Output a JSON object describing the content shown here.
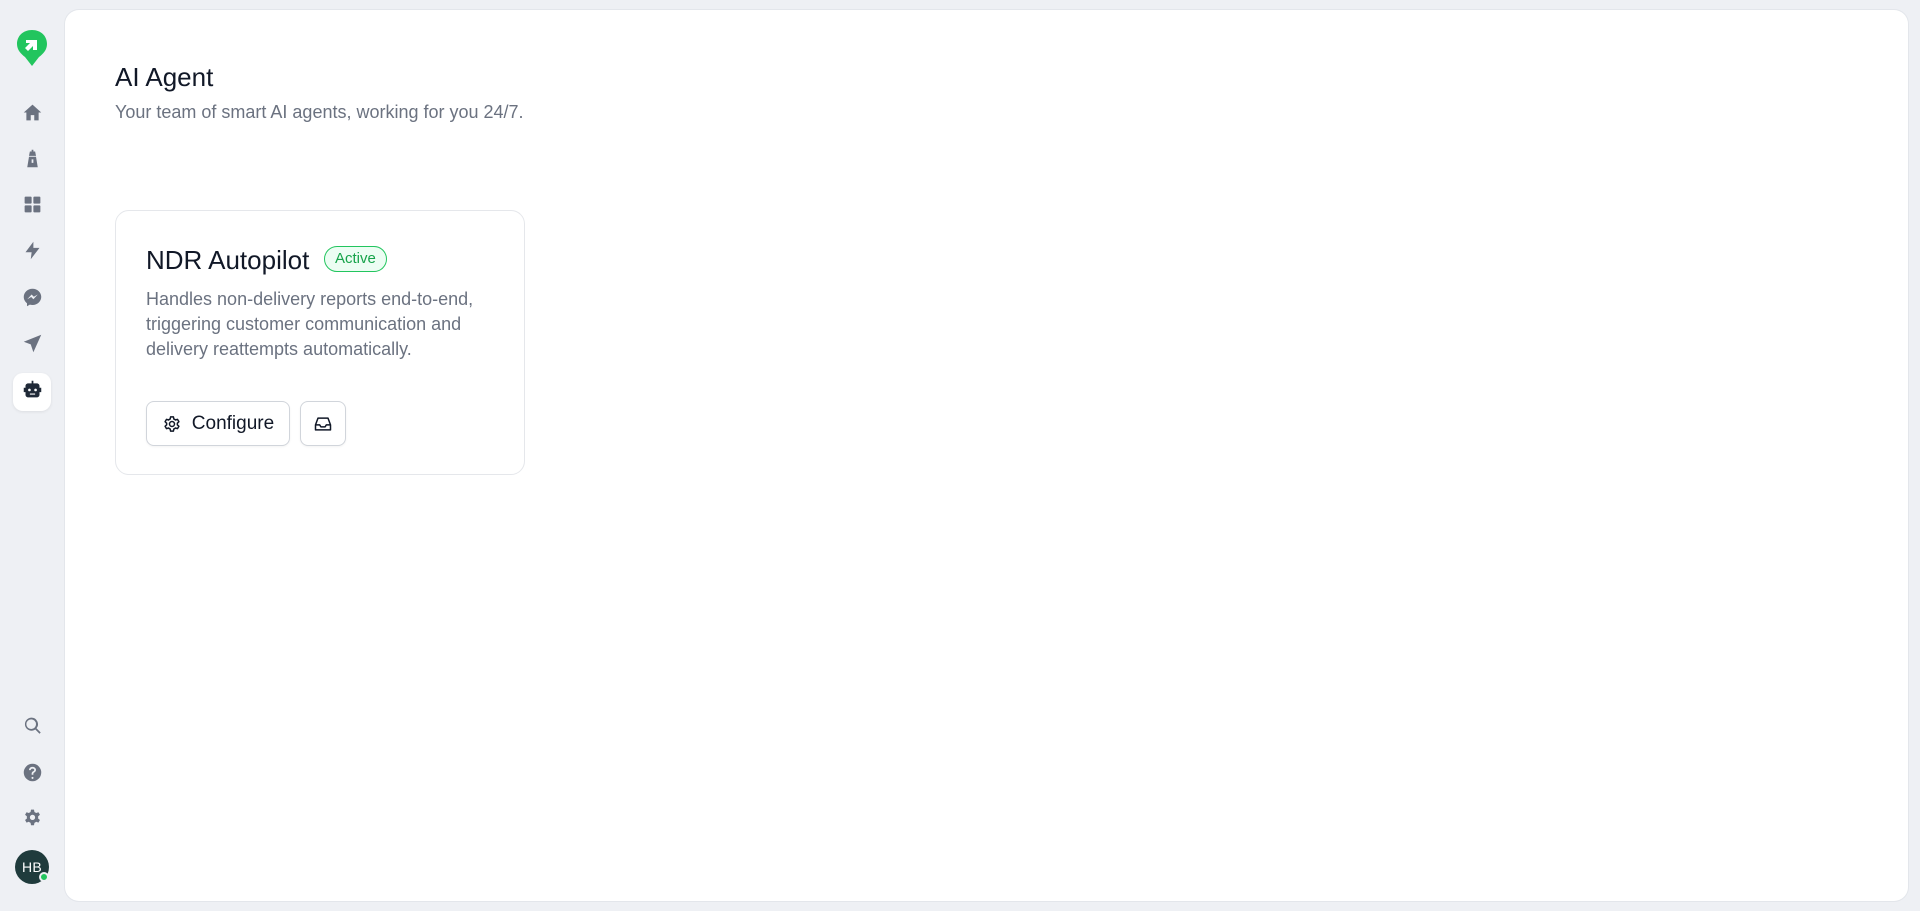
{
  "sidebar": {
    "logo": "brand-logo",
    "nav_items": [
      {
        "icon": "home-icon",
        "active": false
      },
      {
        "icon": "lighthouse-icon",
        "active": false
      },
      {
        "icon": "grid-icon",
        "active": false
      },
      {
        "icon": "lightning-icon",
        "active": false
      },
      {
        "icon": "chat-icon",
        "active": false
      },
      {
        "icon": "send-icon",
        "active": false
      },
      {
        "icon": "robot-icon",
        "active": true
      }
    ],
    "bottom_items": [
      {
        "icon": "search-icon"
      },
      {
        "icon": "help-icon"
      },
      {
        "icon": "gear-icon"
      }
    ],
    "avatar_initials": "HB",
    "presence_color": "#22c55e"
  },
  "page": {
    "title": "AI Agent",
    "subtitle": "Your team of smart AI agents, working for you 24/7."
  },
  "agent_card": {
    "name": "NDR Autopilot",
    "status": "Active",
    "status_color": "#16a34a",
    "description": "Handles non-delivery reports end-to-end, triggering customer communication and delivery reattempts automatically.",
    "configure_label": "Configure"
  }
}
